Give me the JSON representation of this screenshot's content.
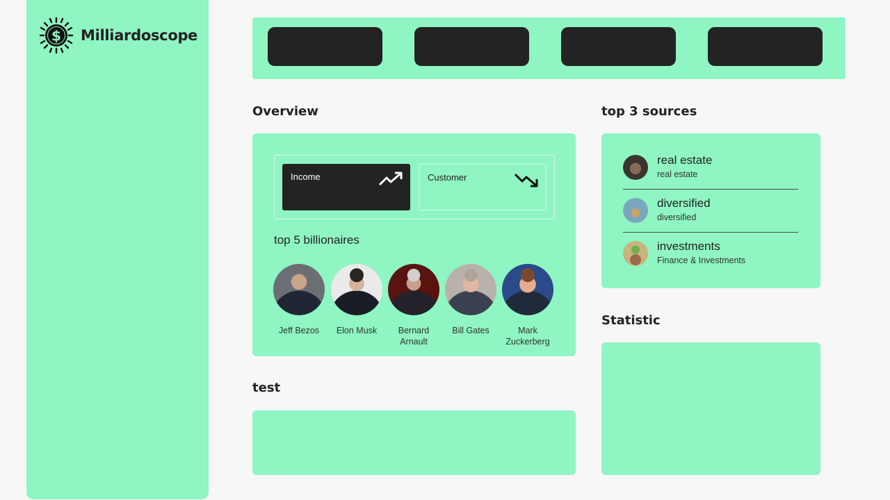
{
  "app": {
    "name": "Milliardoscope",
    "icon": "dollar-sun-icon"
  },
  "topbar": {
    "buttons": [
      "",
      "",
      "",
      ""
    ]
  },
  "overview": {
    "title": "Overview",
    "cards": [
      {
        "label": "Income",
        "icon": "trending-up-icon",
        "bg": "#232323"
      },
      {
        "label": "Customer",
        "icon": "trending-down-icon",
        "bg": "#8ff5c3"
      }
    ],
    "billionaires_title": "top 5 billionaires",
    "billionaires": [
      {
        "name": "Jeff Bezos"
      },
      {
        "name": "Elon Musk"
      },
      {
        "name": "Bernard Arnault"
      },
      {
        "name": "Bill Gates"
      },
      {
        "name": "Mark Zuckerberg"
      }
    ]
  },
  "sources": {
    "title": "top 3 sources",
    "items": [
      {
        "title": "real estate",
        "subtitle": "real estate"
      },
      {
        "title": "diversified",
        "subtitle": "diversified"
      },
      {
        "title": "investments",
        "subtitle": "Finance & Investments"
      }
    ]
  },
  "test": {
    "title": "test"
  },
  "statistic": {
    "title": "Statistic"
  },
  "colors": {
    "accent": "#8ff5c3",
    "dark": "#232323",
    "background": "#f7f7f7"
  }
}
